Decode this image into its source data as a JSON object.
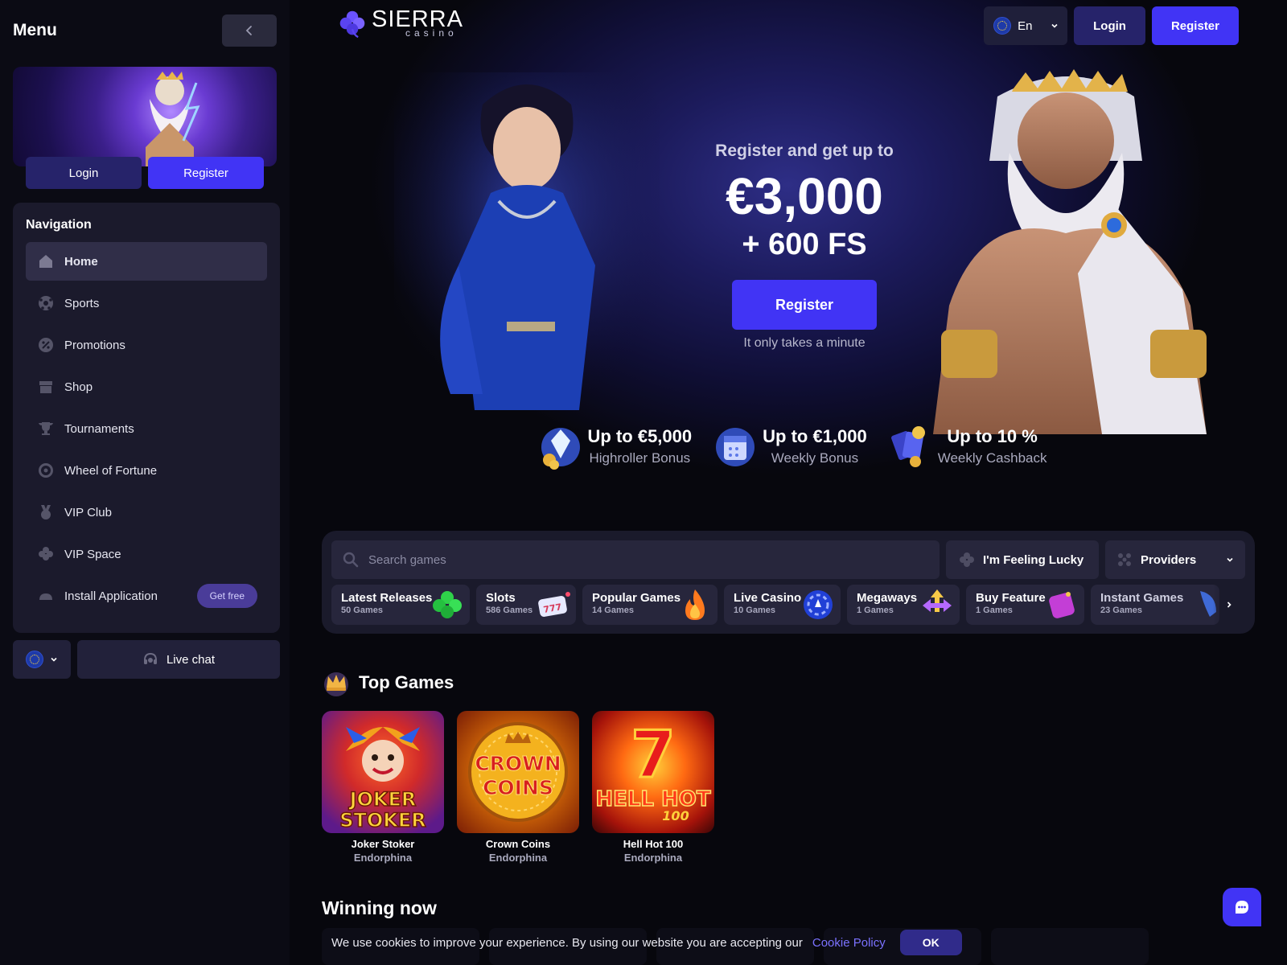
{
  "sidebar": {
    "title": "Menu",
    "login_label": "Login",
    "register_label": "Register",
    "nav_title": "Navigation",
    "items": [
      {
        "label": "Home",
        "icon": "home-icon"
      },
      {
        "label": "Sports",
        "icon": "soccer-ball-icon"
      },
      {
        "label": "Promotions",
        "icon": "percent-badge-icon"
      },
      {
        "label": "Shop",
        "icon": "store-icon"
      },
      {
        "label": "Tournaments",
        "icon": "trophy-icon"
      },
      {
        "label": "Wheel of Fortune",
        "icon": "wheel-icon"
      },
      {
        "label": "VIP Club",
        "icon": "medal-icon"
      },
      {
        "label": "VIP Space",
        "icon": "clover-icon"
      },
      {
        "label": "Install Application",
        "icon": "android-icon"
      }
    ],
    "get_free_label": "Get free",
    "live_chat_label": "Live chat"
  },
  "header": {
    "logo_text": "SIERRA",
    "logo_sub": "casino",
    "language": "En",
    "login_label": "Login",
    "register_label": "Register"
  },
  "hero": {
    "subtitle": "Register and get up to",
    "amount": "€3,000",
    "free_spins": "+ 600 FS",
    "cta_label": "Register",
    "note": "It only takes a minute"
  },
  "bonuses": [
    {
      "main": "Up to €5,000",
      "sub": "Highroller Bonus",
      "icon": "diamond-coins-icon"
    },
    {
      "main": "Up to €1,000",
      "sub": "Weekly Bonus",
      "icon": "calendar-icon"
    },
    {
      "main": "Up to 10 %",
      "sub": "Weekly Cashback",
      "icon": "cards-coins-icon"
    }
  ],
  "games_bar": {
    "search_placeholder": "Search games",
    "lucky_label": "I'm Feeling Lucky",
    "providers_label": "Providers",
    "categories": [
      {
        "name": "Latest Releases",
        "count": "50 Games",
        "icon": "clover-icon"
      },
      {
        "name": "Slots",
        "count": "586 Games",
        "icon": "slot-machine-icon"
      },
      {
        "name": "Popular Games",
        "count": "14 Games",
        "icon": "fire-icon"
      },
      {
        "name": "Live Casino",
        "count": "10 Games",
        "icon": "chip-icon"
      },
      {
        "name": "Megaways",
        "count": "1 Games",
        "icon": "arrows-icon"
      },
      {
        "name": "Buy Feature",
        "count": "1 Games",
        "icon": "buy-tag-icon"
      },
      {
        "name": "Instant Games",
        "count": "23 Games",
        "icon": "rocket-icon"
      }
    ]
  },
  "top_games": {
    "title": "Top Games",
    "games": [
      {
        "name": "Joker Stoker",
        "provider": "Endorphina",
        "art": "JOKER STOKER"
      },
      {
        "name": "Crown Coins",
        "provider": "Endorphina",
        "art": "CROWN COINS"
      },
      {
        "name": "Hell Hot 100",
        "provider": "Endorphina",
        "art": "HELL HOT"
      }
    ]
  },
  "winning_now": {
    "title": "Winning now"
  },
  "cookie": {
    "text": "We use cookies to improve your experience. By using our website you are accepting our",
    "link_label": "Cookie Policy",
    "ok_label": "OK"
  },
  "colors": {
    "accent": "#4134f5",
    "sidebar_bg": "#0b0b14",
    "panel_bg": "#1b1a2c"
  }
}
